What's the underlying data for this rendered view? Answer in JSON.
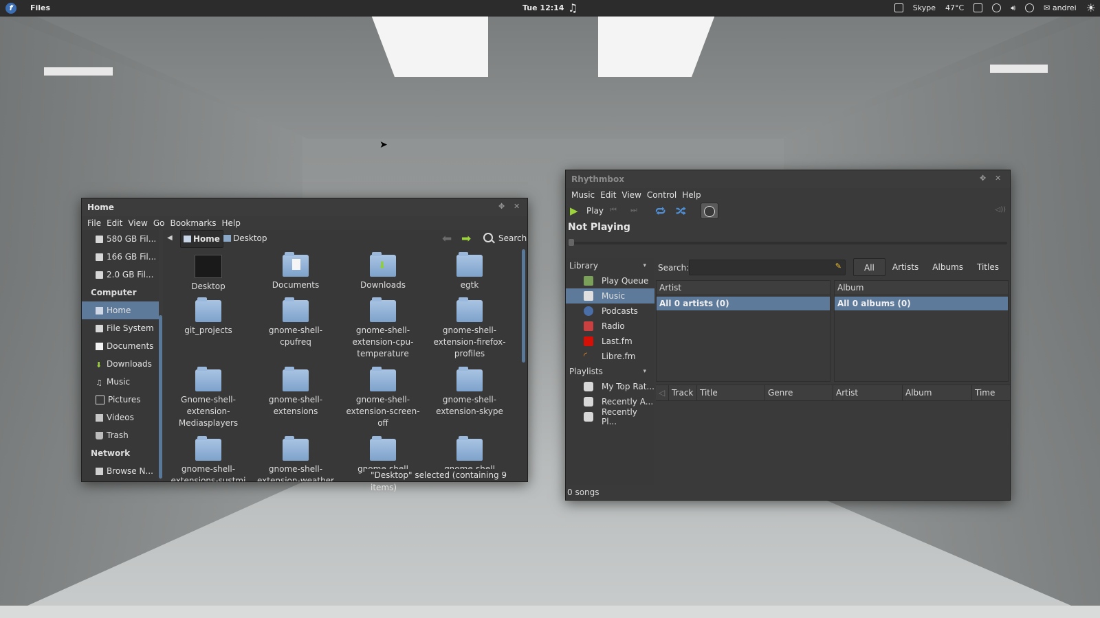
{
  "panel": {
    "app_menu": "Files",
    "clock": "Tue 12:14",
    "tray": {
      "skype": "Skype",
      "temperature": "47°C",
      "user": "andrei"
    }
  },
  "files": {
    "title": "Home",
    "menu": [
      "File",
      "Edit",
      "View",
      "Go",
      "Bookmarks",
      "Help"
    ],
    "devices": [
      "580 GB Fil...",
      "166 GB Fil...",
      "2.0 GB Fil..."
    ],
    "computer_heading": "Computer",
    "places": [
      "Home",
      "File System",
      "Documents",
      "Downloads",
      "Music",
      "Pictures",
      "Videos",
      "Trash"
    ],
    "network_heading": "Network",
    "network": [
      "Browse N..."
    ],
    "breadcrumb": {
      "current": "Home",
      "next": "Desktop"
    },
    "search_label": "Search",
    "items": [
      "Desktop",
      "Documents",
      "Downloads",
      "egtk",
      "git_projects",
      "gnome-shell-cpufreq",
      "gnome-shell-extension-cpu-temperature",
      "gnome-shell-extension-firefox-profiles",
      "Gnome-shell-extension-Mediasplayers",
      "gnome-shell-extensions",
      "gnome-shell-extension-screen-off",
      "gnome-shell-extension-skype",
      "gnome-shell-extensions-sustmi",
      "gnome-shell-extension-weather",
      "gnome-shell",
      "gnome-shell"
    ],
    "status": "\"Desktop\" selected (containing 9 items)"
  },
  "rhythmbox": {
    "title": "Rhythmbox",
    "menu": [
      "Music",
      "Edit",
      "View",
      "Control",
      "Help"
    ],
    "play_label": "Play",
    "now_playing": "Not Playing",
    "library_heading": "Library",
    "library": [
      "Play Queue",
      "Music",
      "Podcasts",
      "Radio",
      "Last.fm",
      "Libre.fm"
    ],
    "playlists_heading": "Playlists",
    "playlists": [
      "My Top Rat...",
      "Recently A...",
      "Recently Pl..."
    ],
    "search_label": "Search:",
    "filters": [
      "All",
      "Artists",
      "Albums",
      "Titles"
    ],
    "artist_header": "Artist",
    "artist_all": "All 0 artists (0)",
    "album_header": "Album",
    "album_all": "All 0 albums (0)",
    "track_columns": [
      "Track",
      "Title",
      "Genre",
      "Artist",
      "Album",
      "Time"
    ],
    "status": "0 songs"
  }
}
